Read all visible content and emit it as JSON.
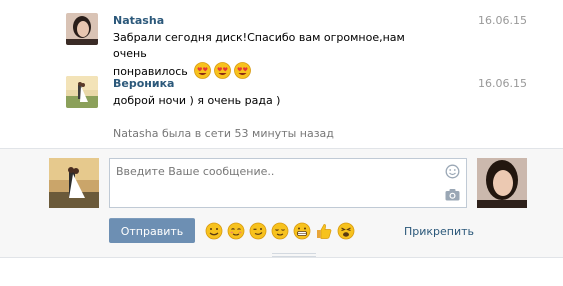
{
  "messages": [
    {
      "author": "Natasha",
      "date": "16.06.15",
      "text_line1": "Забрали сегодня диск!Спасибо вам огромное,нам очень",
      "text_line2": "понравилось",
      "emoji": [
        "heart-eyes-emoji",
        "heart-eyes-emoji",
        "heart-eyes-emoji"
      ]
    },
    {
      "author": "Вероника",
      "date": "16.06.15",
      "text_line1": "доброй ночи ) я очень рада )"
    }
  ],
  "status": "Natasha была в сети 53 минуты назад",
  "composer": {
    "placeholder": "Введите Ваше сообщение..",
    "send_label": "Отправить",
    "attach_label": "Прикрепить",
    "emoji_bar": [
      "smile-emoji",
      "blush-emoji",
      "wink-emoji",
      "relieved-emoji",
      "grin-emoji",
      "thumbs-up-emoji",
      "weary-emoji"
    ]
  },
  "colors": {
    "link": "#2b587a",
    "button": "#6d8fb3",
    "date": "#999999",
    "status": "#777777"
  }
}
